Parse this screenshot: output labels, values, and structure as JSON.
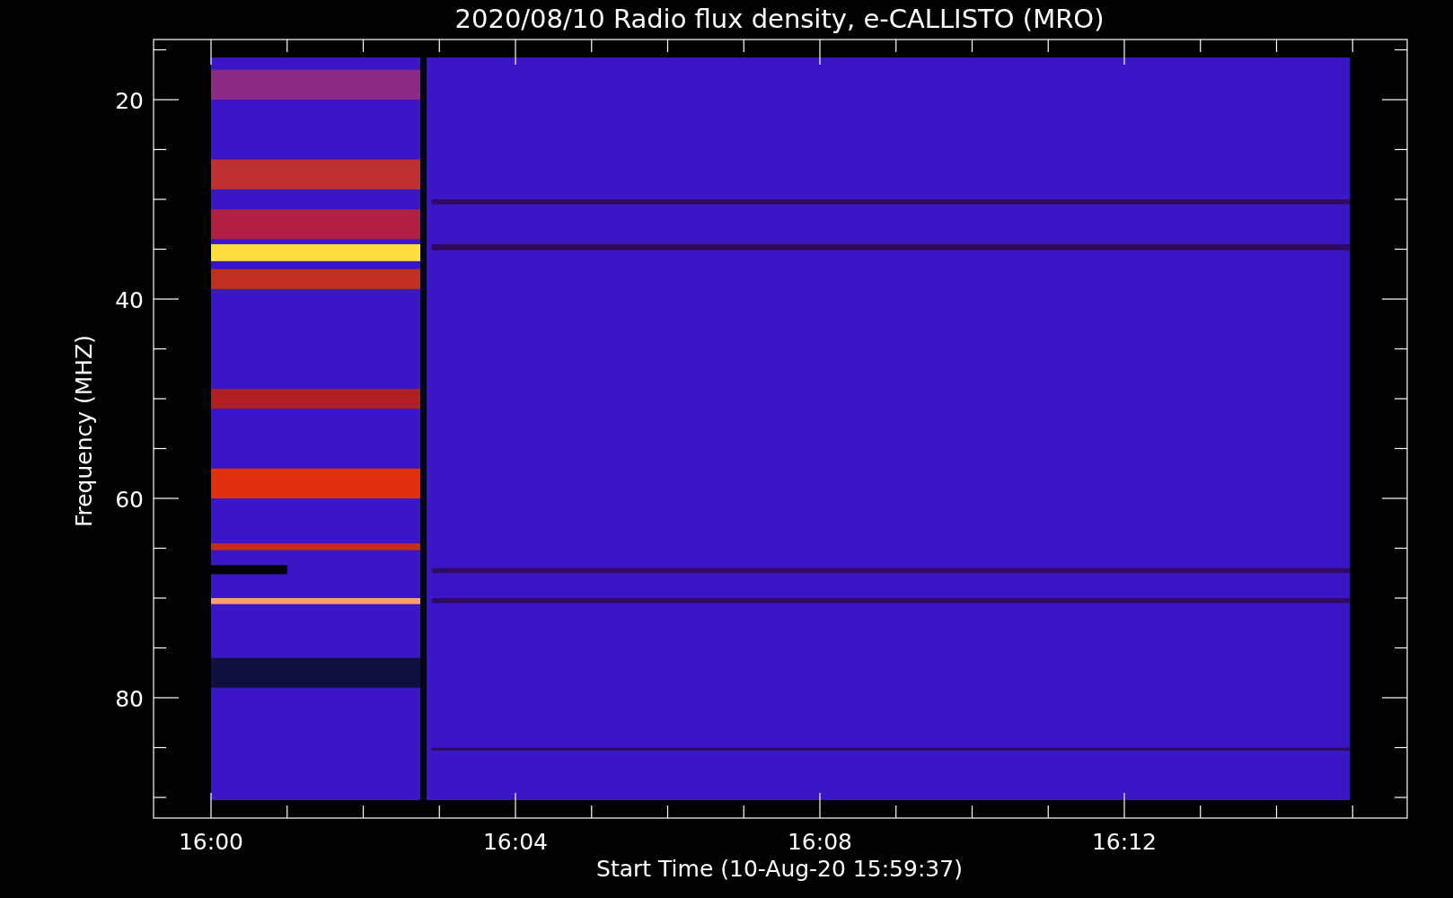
{
  "title": "2020/08/10  Radio flux density, e-CALLISTO (MRO)",
  "plot": {
    "ylabel": "Frequency (MHZ)",
    "xlabel": "Start Time (10-Aug-20 15:59:37)",
    "yticks": [
      "20",
      "40",
      "60",
      "80"
    ],
    "xticks": [
      "16:00",
      "16:04",
      "16:08",
      "16:12"
    ]
  }
}
